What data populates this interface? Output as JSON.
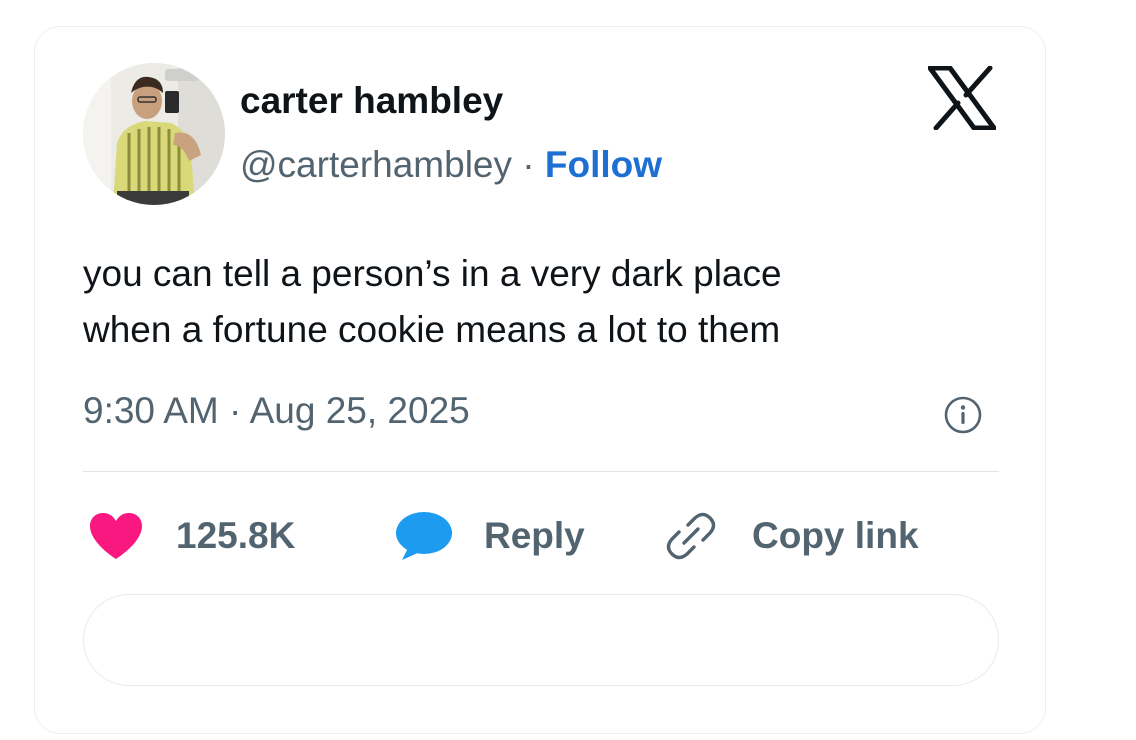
{
  "author": {
    "display_name": "carter hambley",
    "handle": "@carterhambley",
    "separator": "·",
    "follow_label": "Follow"
  },
  "tweet": {
    "text_lines": [
      "you can tell a person’s in a very dark place",
      "when a fortune cookie means a lot to them"
    ],
    "timestamp": "9:30 AM · Aug 25, 2025"
  },
  "actions": {
    "like_count": "125.8K",
    "reply_label": "Reply",
    "copy_link_label": "Copy link"
  },
  "colors": {
    "like": "#f91880",
    "reply": "#1d9bf0",
    "follow": "#1d6fd1",
    "text": "#0f1419",
    "muted": "#536471"
  },
  "icons": {
    "brand": "x-logo-icon",
    "info": "info-icon",
    "like": "heart-icon",
    "reply": "speech-bubble-icon",
    "copy_link": "link-icon"
  }
}
